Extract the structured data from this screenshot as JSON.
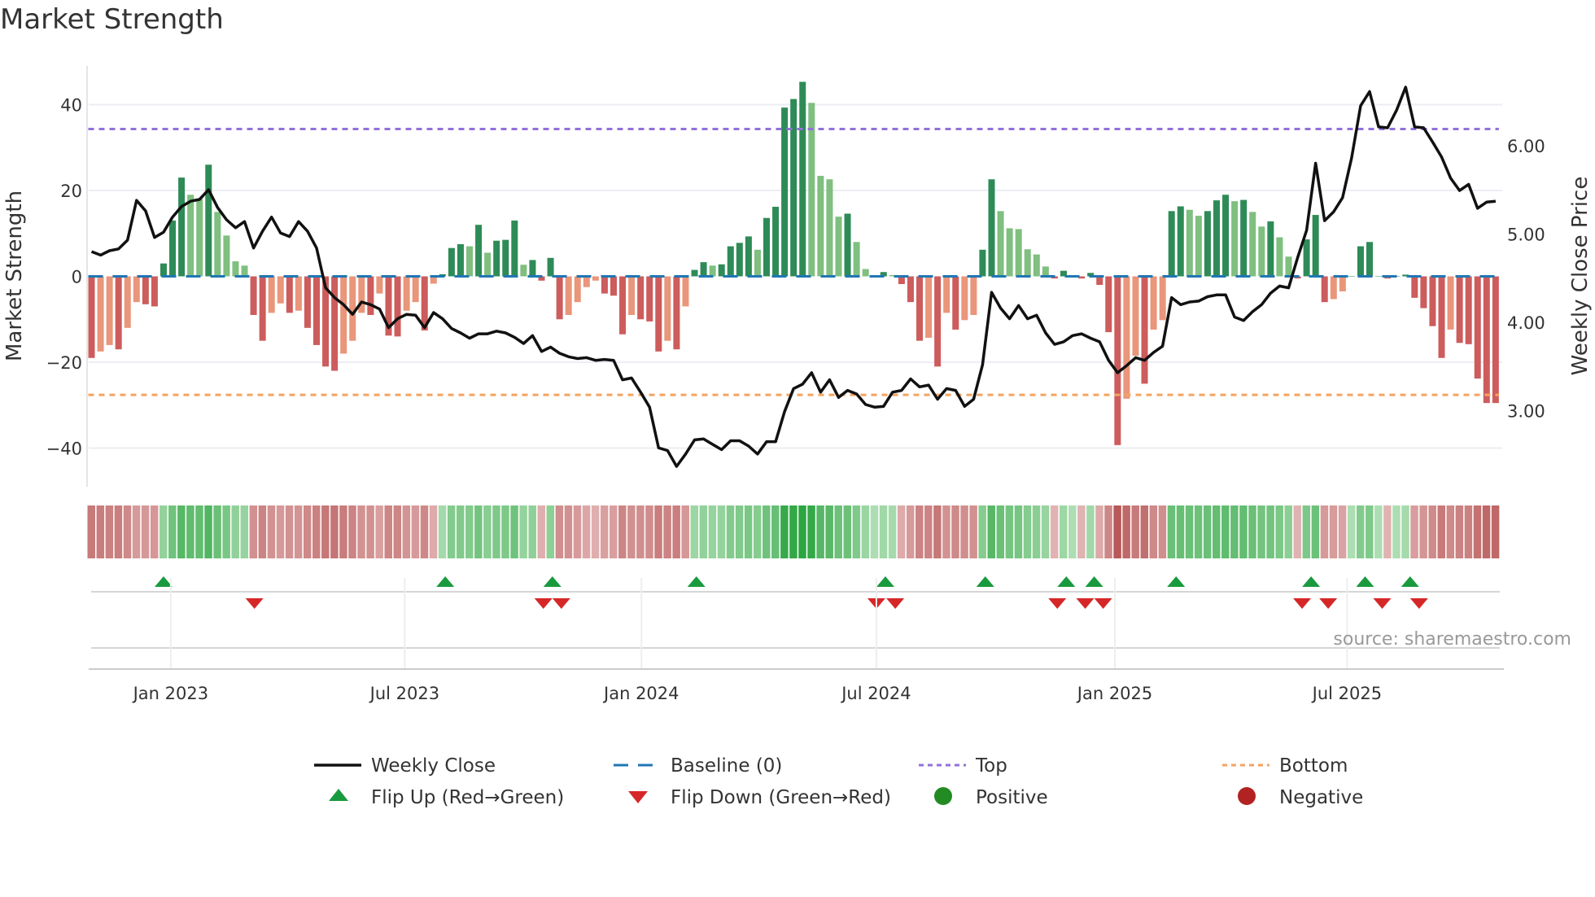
{
  "title": "Market Strength",
  "source": "source: sharemaestro.com",
  "colors": {
    "bar_pos_strong": "#2e8b57",
    "bar_pos_weak": "#7fbf7f",
    "bar_neg_strong": "#cd5c5c",
    "bar_neg_weak": "#e9967a",
    "baseline": "#1f77b4",
    "top": "#9370db",
    "bottom": "#f4a460",
    "price": "#111111",
    "flip_up": "#1a9a3e",
    "flip_down": "#d62728",
    "positive": "#228b22",
    "negative": "#b22222"
  },
  "legend": [
    {
      "label": "Weekly Close",
      "kind": "line"
    },
    {
      "label": "Baseline (0)",
      "kind": "baseline"
    },
    {
      "label": "Top",
      "kind": "top"
    },
    {
      "label": "Bottom",
      "kind": "bottom"
    },
    {
      "label": "Flip Up (Red→Green)",
      "kind": "up"
    },
    {
      "label": "Flip Down (Green→Red)",
      "kind": "down"
    },
    {
      "label": "Positive",
      "kind": "positive"
    },
    {
      "label": "Negative",
      "kind": "negative"
    }
  ],
  "chart_data": {
    "type": "bar",
    "title": "Market Strength",
    "ylabel": "Market Strength",
    "y2label": "Weekly Close Price",
    "ylim": [
      -49,
      49
    ],
    "y2lim": [
      2.14,
      6.9
    ],
    "yticks": [
      -40,
      -20,
      0,
      20,
      40
    ],
    "yticklabels": [
      "−40",
      "−20",
      "0",
      "20",
      "40"
    ],
    "y2ticks": [
      3,
      4,
      5,
      6
    ],
    "y2ticklabels": [
      "3.00",
      "4.00",
      "5.00",
      "6.00"
    ],
    "top_level": 34.3,
    "bottom_level": -27.6,
    "baseline": 0,
    "x_unit": "week index",
    "xticks": [
      {
        "week": 8.8,
        "label": "Jan 2023"
      },
      {
        "week": 34.8,
        "label": "Jul 2023"
      },
      {
        "week": 61.1,
        "label": "Jan 2024"
      },
      {
        "week": 87.2,
        "label": "Jul 2024"
      },
      {
        "week": 113.7,
        "label": "Jan 2025"
      },
      {
        "week": 139.5,
        "label": "Jul 2025"
      }
    ],
    "strength": [
      -19,
      -17.5,
      -16,
      -17,
      -12,
      -6,
      -6.5,
      -7,
      3,
      13,
      23,
      19,
      18,
      26,
      15,
      9.5,
      3.5,
      2.5,
      -9,
      -15,
      -8.5,
      -6.3,
      -8.5,
      -8,
      -12,
      -16,
      -21,
      -22,
      -18,
      -15,
      -8.5,
      -9,
      -4,
      -13.8,
      -14,
      -8,
      -6,
      -12.6,
      -1.7,
      0.5,
      6.6,
      7.5,
      7,
      12,
      5.5,
      8.3,
      8.5,
      13,
      2.7,
      3.8,
      -1,
      4.3,
      -10,
      -9,
      -6,
      -2.5,
      -1,
      -4,
      -4.5,
      -13.5,
      -9,
      -10,
      -10.5,
      -17.5,
      -15,
      -17,
      -7,
      1.5,
      3.3,
      2.5,
      2.8,
      7,
      7.8,
      9.3,
      6.2,
      13.6,
      16.2,
      39.3,
      41.3,
      45.3,
      40.4,
      23.4,
      22.6,
      13.9,
      14.6,
      8,
      1.7,
      0,
      1,
      0.3,
      -1.8,
      -6,
      -15,
      -14.3,
      -21,
      -8.5,
      -12.4,
      -10.2,
      -9,
      6.2,
      22.6,
      15.2,
      11.2,
      11,
      6.3,
      5.1,
      2.3,
      -0.5,
      1.3,
      0,
      -0.5,
      0.8,
      -2,
      -13,
      -39.3,
      -28.5,
      -18.5,
      -25,
      -12.4,
      -10.2,
      15.2,
      16.3,
      15.5,
      14.1,
      15.2,
      17.7,
      19,
      17.5,
      17.8,
      15,
      11.6,
      12.8,
      9.1,
      4.6,
      -0.5,
      8.6,
      14.3,
      -6,
      -5.3,
      -3.5,
      0,
      7,
      8,
      0,
      -0.5,
      0,
      0.4,
      -5,
      -7.4,
      -11.6,
      -19,
      -12.4,
      -15.5,
      -15.8,
      -23.8,
      -29.5,
      -29.5
    ],
    "weekly_close": [
      4.8,
      4.76,
      4.81,
      4.83,
      4.93,
      5.38,
      5.26,
      4.96,
      5.02,
      5.19,
      5.31,
      5.37,
      5.39,
      5.5,
      5.3,
      5.16,
      5.07,
      5.14,
      4.84,
      5.03,
      5.19,
      5.01,
      4.97,
      5.14,
      5.03,
      4.84,
      4.39,
      4.28,
      4.2,
      4.09,
      4.23,
      4.2,
      4.15,
      3.94,
      4.04,
      4.09,
      4.08,
      3.94,
      4.11,
      4.04,
      3.93,
      3.88,
      3.82,
      3.87,
      3.87,
      3.9,
      3.88,
      3.83,
      3.76,
      3.85,
      3.67,
      3.72,
      3.65,
      3.61,
      3.59,
      3.6,
      3.57,
      3.58,
      3.57,
      3.35,
      3.37,
      3.21,
      3.04,
      2.58,
      2.55,
      2.37,
      2.51,
      2.67,
      2.68,
      2.62,
      2.56,
      2.66,
      2.66,
      2.6,
      2.51,
      2.65,
      2.65,
      2.99,
      3.25,
      3.3,
      3.43,
      3.21,
      3.35,
      3.15,
      3.23,
      3.19,
      3.07,
      3.04,
      3.05,
      3.21,
      3.23,
      3.36,
      3.27,
      3.29,
      3.13,
      3.25,
      3.23,
      3.05,
      3.13,
      3.52,
      4.34,
      4.16,
      4.04,
      4.19,
      4.04,
      4.08,
      3.88,
      3.75,
      3.78,
      3.85,
      3.87,
      3.82,
      3.78,
      3.57,
      3.43,
      3.51,
      3.6,
      3.57,
      3.66,
      3.73,
      4.28,
      4.2,
      4.23,
      4.24,
      4.29,
      4.31,
      4.31,
      4.06,
      4.02,
      4.12,
      4.2,
      4.33,
      4.41,
      4.39,
      4.73,
      5.04,
      5.8,
      5.15,
      5.25,
      5.41,
      5.86,
      6.45,
      6.61,
      6.21,
      6.2,
      6.4,
      6.66,
      6.21,
      6.2,
      6.04,
      5.87,
      5.63,
      5.49,
      5.56,
      5.29,
      5.36,
      5.37
    ],
    "flip_up_weeks": [
      8,
      39.3,
      51.2,
      67.2,
      88.2,
      99.3,
      108.3,
      111.4,
      120.5,
      135.5,
      141.5,
      146.5
    ],
    "flip_down_weeks": [
      18.1,
      50.2,
      52.2,
      87.2,
      89.3,
      107.3,
      110.4,
      112.4,
      134.5,
      137.4,
      143.4,
      147.5
    ],
    "legend_position": "bottom"
  }
}
